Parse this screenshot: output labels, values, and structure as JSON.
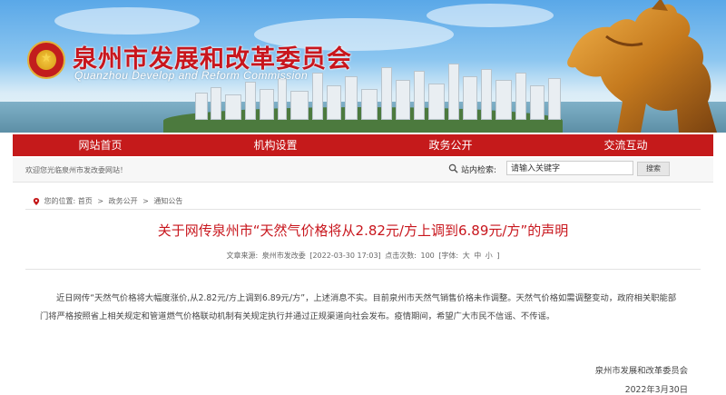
{
  "header": {
    "title": "泉州市发展和改革委员会",
    "subtitle_en": "Quanzhou Develop and Reform Commission"
  },
  "nav": {
    "items": [
      {
        "label": "网站首页"
      },
      {
        "label": "机构设置"
      },
      {
        "label": "政务公开"
      },
      {
        "label": "交流互动"
      }
    ]
  },
  "infobar": {
    "welcome": "欢迎您光临泉州市发改委网站！",
    "search_label": "站内检索:",
    "search_placeholder": "请输入关键字",
    "search_button": "搜索"
  },
  "breadcrumb": {
    "prefix": "您的位置:",
    "items": [
      "首页",
      "政务公开",
      "通知公告"
    ],
    "separator": ">"
  },
  "article": {
    "title": "关于网传泉州市“天然气价格将从2.82元/方上调到6.89元/方”的声明",
    "meta": {
      "source_label": "文章来源:",
      "source": "泉州市发改委",
      "datetime": "[2022-03-30 17:03]",
      "views_label": "点击次数:",
      "views": "100",
      "font_label": "[字体:",
      "font_sizes": [
        "大",
        "中",
        "小"
      ],
      "font_end": "]"
    },
    "body": "近日网传“天然气价格将大幅度涨价,从2.82元/方上调到6.89元/方”，上述消息不实。目前泉州市天然气销售价格未作调整。天然气价格如需调整变动，政府相关职能部门将严格按照省上相关规定和管道燃气价格联动机制有关规定执行并通过正规渠道向社会发布。疫情期间，希望广大市民不信谣、不传谣。",
    "signature": "泉州市发展和改革委员会",
    "date": "2022年3月30日"
  },
  "colors": {
    "brand_red": "#c51a1b",
    "title_red": "#c8161d"
  }
}
